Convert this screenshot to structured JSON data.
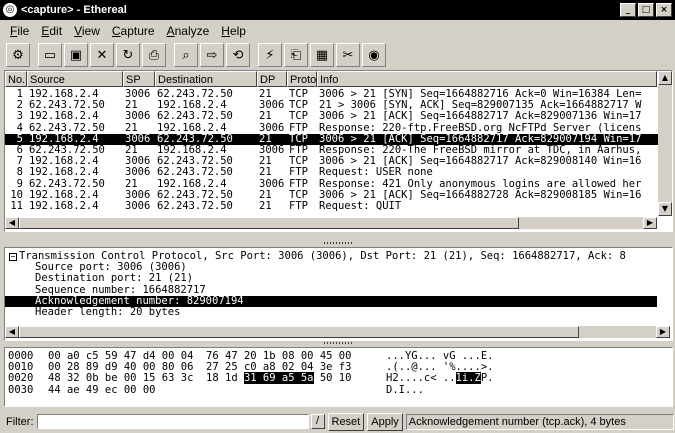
{
  "window": {
    "title": "<capture> - Ethereal",
    "app_icon": "ethereal-logo-icon"
  },
  "menu": [
    "File",
    "Edit",
    "View",
    "Capture",
    "Analyze",
    "Help"
  ],
  "toolbar": {
    "buttons": [
      "capture-start-icon",
      "open-folder-icon",
      "save-icon",
      "close-icon",
      "reload-icon",
      "print-icon",
      "find-icon",
      "go-forward-icon",
      "go-to-packet-icon",
      "capture-filter-icon",
      "display-filter-icon",
      "coloring-rules-icon",
      "preferences-icon",
      "help-icon"
    ]
  },
  "packet_list": {
    "columns": [
      "No.",
      "Source",
      "SP",
      "Destination",
      "DP",
      "Protocol",
      "Info"
    ],
    "rows": [
      [
        "1",
        "192.168.2.4",
        "3006",
        "62.243.72.50",
        "21",
        "TCP",
        "3006 > 21 [SYN] Seq=1664882716 Ack=0 Win=16384 Len="
      ],
      [
        "2",
        "62.243.72.50",
        "21",
        "192.168.2.4",
        "3006",
        "TCP",
        "21 > 3006 [SYN, ACK] Seq=829007135 Ack=1664882717 W"
      ],
      [
        "3",
        "192.168.2.4",
        "3006",
        "62.243.72.50",
        "21",
        "TCP",
        "3006 > 21 [ACK] Seq=1664882717 Ack=829007136 Win=17"
      ],
      [
        "4",
        "62.243.72.50",
        "21",
        "192.168.2.4",
        "3006",
        "FTP",
        "Response: 220-ftp.FreeBSD.org NcFTPd Server (licens"
      ],
      [
        "5",
        "192.168.2.4",
        "3006",
        "62.243.72.50",
        "21",
        "TCP",
        "3006 > 21 [ACK] Seq=1664882717 Ack=829007194 Win=17"
      ],
      [
        "6",
        "62.243.72.50",
        "21",
        "192.168.2.4",
        "3006",
        "FTP",
        "Response: 220-The FreeBSD mirror at TDC, in Aarhus,"
      ],
      [
        "7",
        "192.168.2.4",
        "3006",
        "62.243.72.50",
        "21",
        "TCP",
        "3006 > 21 [ACK] Seq=1664882717 Ack=829008140 Win=16"
      ],
      [
        "8",
        "192.168.2.4",
        "3006",
        "62.243.72.50",
        "21",
        "FTP",
        "Request: USER none"
      ],
      [
        "9",
        "62.243.72.50",
        "21",
        "192.168.2.4",
        "3006",
        "FTP",
        "Response: 421 Only anonymous logins are allowed her"
      ],
      [
        "10",
        "192.168.2.4",
        "3006",
        "62.243.72.50",
        "21",
        "TCP",
        "3006 > 21 [ACK] Seq=1664882728 Ack=829008185 Win=16"
      ],
      [
        "11",
        "192.168.2.4",
        "3006",
        "62.243.72.50",
        "21",
        "FTP",
        "Request: QUIT"
      ]
    ],
    "selected_index": 4
  },
  "details": {
    "header": "Transmission Control Protocol, Src Port: 3006 (3006), Dst Port: 21 (21), Seq: 1664882717, Ack: 8",
    "fields": [
      "Source port: 3006 (3006)",
      "Destination port: 21 (21)",
      "Sequence number: 1664882717",
      "Acknowledgement number: 829007194",
      "Header length: 20 bytes"
    ],
    "selected_index": 3
  },
  "hex": {
    "rows": [
      {
        "offset": "0000",
        "pre": "00 a0 c5 59 47 d4 00 04  76 47 20 1b 08 00 45 00",
        "hl": "",
        "post": "",
        "ascii_pre": "...YG... vG ...E.",
        "ascii_hl": "",
        "ascii_post": ""
      },
      {
        "offset": "0010",
        "pre": "00 28 89 d9 40 00 80 06  27 25 c0 a8 02 04 3e f3",
        "hl": "",
        "post": "",
        "ascii_pre": ".(..@... '%....>.",
        "ascii_hl": "",
        "ascii_post": ""
      },
      {
        "offset": "0020",
        "pre": "48 32 0b be 00 15 63 3c  18 1d ",
        "hl": "31 69 a5 5a",
        "post": " 50 10",
        "ascii_pre": "H2....c< ..",
        "ascii_hl": "1i.Z",
        "ascii_post": "P."
      },
      {
        "offset": "0030",
        "pre": "44 ae 49 ec 00 00",
        "hl": "",
        "post": "",
        "ascii_pre": "D.I...",
        "ascii_hl": "",
        "ascii_post": ""
      }
    ]
  },
  "status": {
    "filter_label": "Filter:",
    "filter_value": "",
    "reset_label": "Reset",
    "apply_label": "Apply",
    "message": "Acknowledgement number (tcp.ack), 4 bytes"
  }
}
